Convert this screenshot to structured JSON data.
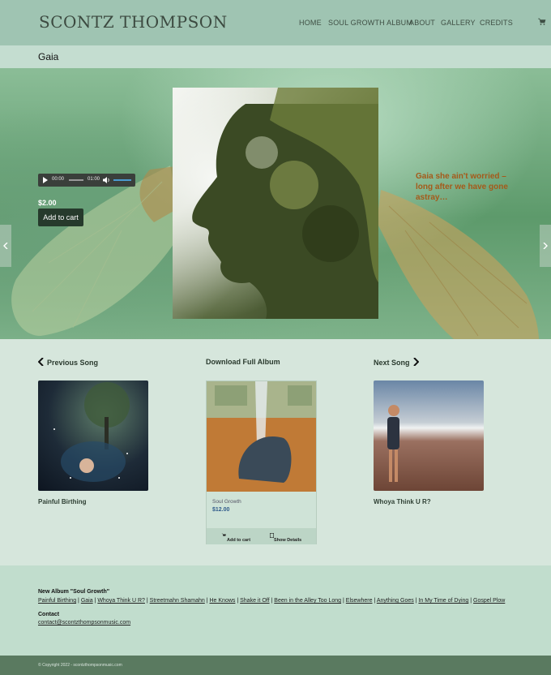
{
  "header": {
    "logo": "SCONTZ THOMPSON",
    "nav": [
      "HOME",
      "SOUL GROWTH ALBUM",
      "ABOUT",
      "GALLERY",
      "CREDITS"
    ]
  },
  "page": {
    "title": "Gaia"
  },
  "player": {
    "current_time": "00:00",
    "duration": "01:00"
  },
  "product": {
    "price": "$2.00",
    "add_to_cart": "Add to cart",
    "quote": "Gaia she ain't worried – long after we have gone astray…"
  },
  "song_nav": {
    "previous_label": "Previous Song",
    "previous_song": "Painful Birthing",
    "album_label": "Download Full Album",
    "next_label": "Next Song",
    "next_song": "Whoya Think U R?"
  },
  "album_card": {
    "name": "Soul Growth",
    "price": "$12.00",
    "add_to_cart": "Add to cart",
    "show_details": "Show Details"
  },
  "footer": {
    "album_heading": "New Album \"Soul Growth\"",
    "tracks": [
      "Painful Birthing",
      "Gaia",
      "Whoya Think U R?",
      "Streetmahn Shamahn",
      "He Knows",
      "Shake it Off",
      "Been in the Alley Too Long",
      "Elsewhere",
      "Anything Goes",
      "In My Time of Dying",
      "Gospel Plow"
    ],
    "contact_heading": "Contact",
    "email": "contact@scontzthompsonmusic.com",
    "copyright": "© Copyright 2022 - scontzthompsonmusic.com"
  },
  "colors": {
    "header_bg": "#9fc4b2",
    "page_bg": "#d6e6dc",
    "quote_color": "#a55a1a",
    "button_bg": "#263a2c",
    "footer_bottom": "#5a7a60"
  },
  "icons": [
    "cart-icon",
    "play-icon",
    "volume-icon",
    "chevron-left-icon",
    "chevron-right-icon",
    "cart-small-icon",
    "document-icon"
  ]
}
